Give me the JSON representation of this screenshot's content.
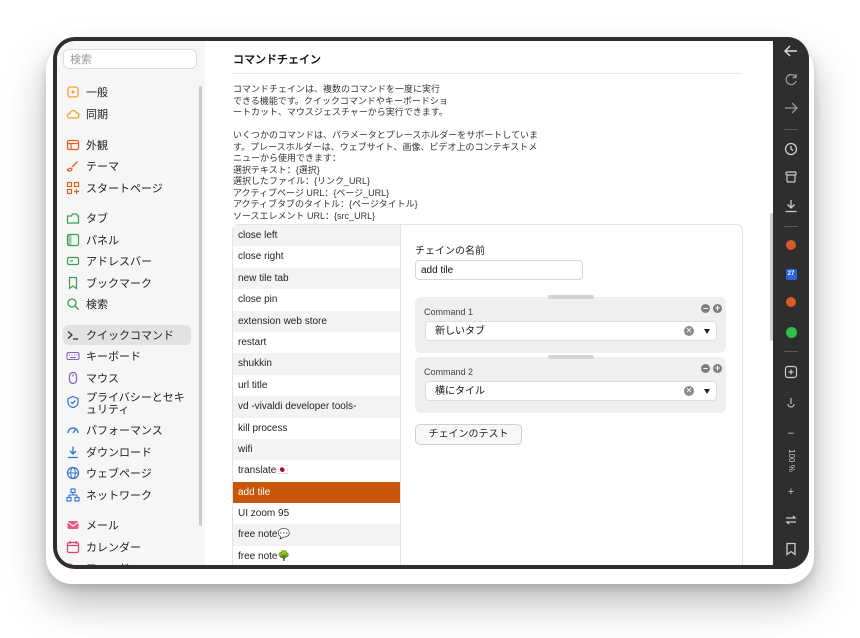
{
  "sidebar": {
    "search_placeholder": "検索",
    "items": [
      {
        "label": "一般",
        "icon": "general-icon",
        "color": "#f0a030"
      },
      {
        "label": "同期",
        "icon": "cloud-icon",
        "color": "#f0a030"
      },
      {
        "label": "外観",
        "icon": "appearance-icon",
        "color": "#e06020"
      },
      {
        "label": "テーマ",
        "icon": "brush-icon",
        "color": "#e06020"
      },
      {
        "label": "スタートページ",
        "icon": "grid-icon",
        "color": "#e06020"
      },
      {
        "label": "タブ",
        "icon": "tabs-icon",
        "color": "#3aa050"
      },
      {
        "label": "パネル",
        "icon": "panel-icon",
        "color": "#3aa050"
      },
      {
        "label": "アドレスバー",
        "icon": "addressbar-icon",
        "color": "#3aa050"
      },
      {
        "label": "ブックマーク",
        "icon": "bookmark-icon",
        "color": "#3aa050"
      },
      {
        "label": "検索",
        "icon": "search-icon",
        "color": "#3aa050"
      },
      {
        "label": "クイックコマンド",
        "icon": "terminal-icon",
        "color": "#333333"
      },
      {
        "label": "キーボード",
        "icon": "keyboard-icon",
        "color": "#8060c0"
      },
      {
        "label": "マウス",
        "icon": "mouse-icon",
        "color": "#8060c0"
      },
      {
        "label": "プライバシーとセキュリティ",
        "icon": "shield-icon",
        "color": "#3070d0"
      },
      {
        "label": "パフォーマンス",
        "icon": "gauge-icon",
        "color": "#3070d0"
      },
      {
        "label": "ダウンロード",
        "icon": "download-icon",
        "color": "#3070d0"
      },
      {
        "label": "ウェブページ",
        "icon": "globe-icon",
        "color": "#3070d0"
      },
      {
        "label": "ネットワーク",
        "icon": "network-icon",
        "color": "#3070d0"
      },
      {
        "label": "メール",
        "icon": "mail-icon",
        "color": "#e04070"
      },
      {
        "label": "カレンダー",
        "icon": "calendar-icon",
        "color": "#e04070"
      },
      {
        "label": "フィード",
        "icon": "feed-icon",
        "color": "#e04070"
      }
    ]
  },
  "main": {
    "title": "コマンドチェイン",
    "desc1": [
      "コマンドチェインは、複数のコマンドを一度に実行",
      "できる機能です。クイックコマンドやキーボードショ",
      "ートカット、マウスジェスチャーから実行できます。"
    ],
    "desc2": [
      "いくつかのコマンドは、パラメータとプレースホルダーをサポートしていま",
      "す。プレースホルダーは、ウェブサイト、画像、ビデオ上のコンテキストメ",
      "ニューから使用できます：",
      "選択テキスト：{選択}",
      "選択したファイル：{リンク_URL}",
      "アクティブページ URL：{ページ_URL}",
      "アクティブタブのタイトル：{ページタイトル}",
      "ソースエレメント URL：{src_URL}"
    ],
    "chains": [
      "close left",
      "close right",
      "new tile tab",
      "close pin",
      "extension web store",
      "restart",
      "shukkin",
      "url title",
      "vd -vivaldi developer tools-",
      "kill process",
      "wifi",
      "translate🇯🇵",
      "add tile",
      "UI zoom 95",
      "free note💬",
      "free note🌳"
    ],
    "selected_index": 12,
    "chain_name_label": "チェインの名前",
    "chain_name_value": "add tile",
    "commands": [
      {
        "name": "Command 1",
        "value": "新しいタブ"
      },
      {
        "name": "Command 2",
        "value": "横にタイル"
      }
    ],
    "test_button": "チェインのテスト",
    "accent_color": "#c8560a"
  },
  "toolbar": {
    "zoom_label": "100 %"
  }
}
